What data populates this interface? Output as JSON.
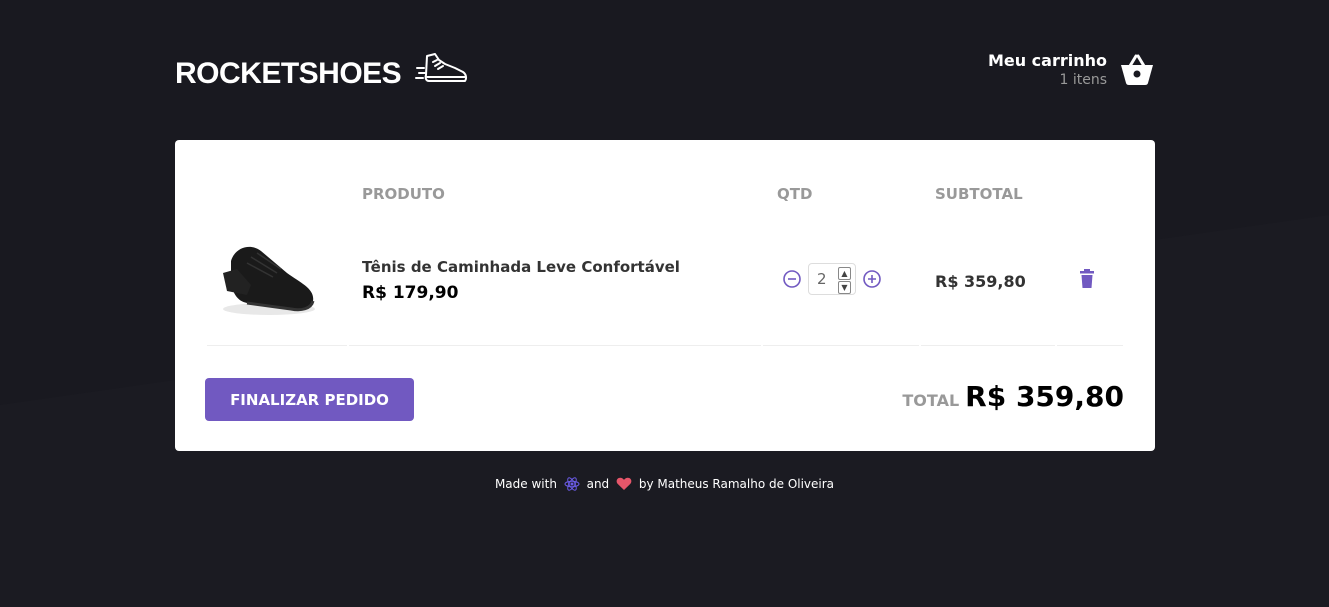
{
  "header": {
    "logo_text": "ROCKETSHOES",
    "logo_icon": "sneaker-icon",
    "cart_title": "Meu carrinho",
    "cart_count": "1 itens",
    "cart_icon": "basket-icon"
  },
  "table": {
    "headers": {
      "product": "PRODUTO",
      "qty": "QTD",
      "subtotal": "SUBTOTAL"
    },
    "rows": [
      {
        "title": "Tênis de Caminhada Leve Confortável",
        "price": "R$ 179,90",
        "quantity": "2",
        "subtotal": "R$ 359,80"
      }
    ]
  },
  "footer_bar": {
    "button_label": "FINALIZAR PEDIDO",
    "total_label": "TOTAL",
    "total_value": "R$ 359,80"
  },
  "credits": {
    "made_with": "Made with",
    "and": "and",
    "by": "by Matheus Ramalho de Oliveira"
  },
  "colors": {
    "background": "#191920",
    "accent": "#7159c1",
    "heart": "#e6566a"
  }
}
